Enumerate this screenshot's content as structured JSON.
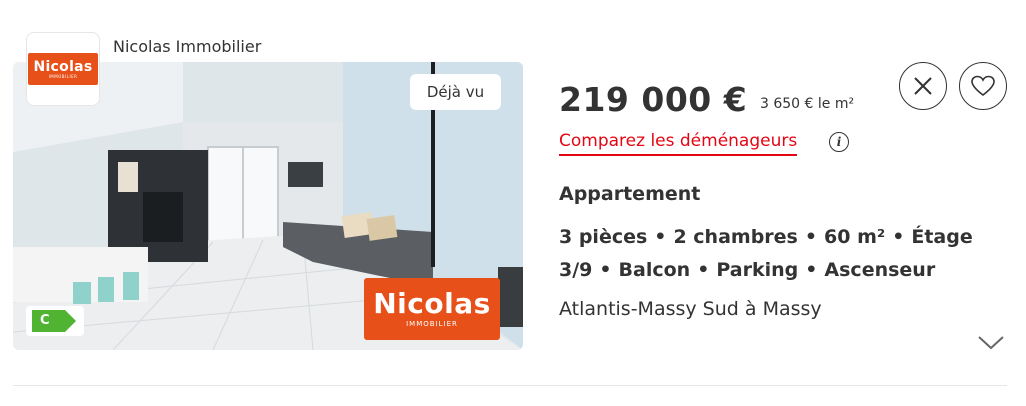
{
  "agency": {
    "name": "Nicolas Immobilier",
    "logo_text": "Nicolas",
    "logo_subtext": "IMMOBILIER"
  },
  "photo": {
    "seen_label": "Déjà vu",
    "energy_class": "C",
    "brand_text": "Nicolas",
    "brand_subtext": "IMMOBILIER"
  },
  "listing": {
    "price": "219 000 €",
    "price_per_m2": "3 650 € le m²",
    "compare_link": "Comparez les déménageurs",
    "property_type": "Appartement",
    "features": [
      "3 pièces",
      "2 chambres",
      "60 m²",
      "Étage 3/9",
      "Balcon",
      "Parking",
      "Ascenseur"
    ],
    "feature_separator": "•",
    "location": "Atlantis-Massy Sud à Massy"
  },
  "actions": {
    "close_icon": "close-icon",
    "favorite_icon": "heart-icon",
    "expand_icon": "chevron-down-icon"
  },
  "colors": {
    "brand": "#e8501a",
    "link": "#e30613",
    "energy_c": "#50b432"
  }
}
